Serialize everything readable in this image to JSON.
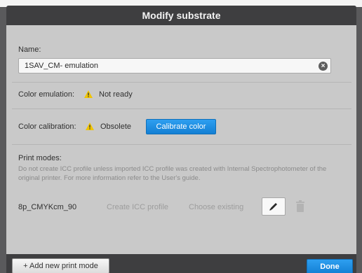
{
  "dialog": {
    "title": "Modify substrate"
  },
  "name": {
    "label": "Name:",
    "value": "1SAV_CM- emulation",
    "clear_icon": "clear-circle-x-icon"
  },
  "color_emulation": {
    "label": "Color emulation:",
    "status": "Not ready",
    "icon": "warning-icon"
  },
  "color_calibration": {
    "label": "Color calibration:",
    "status": "Obsolete",
    "icon": "warning-icon",
    "button_label": "Calibrate color"
  },
  "print_modes": {
    "label": "Print modes:",
    "description": "Do not create ICC profile unless imported ICC profile was created with Internal Spectrophotometer of the original printer. For more information refer to the User's guide.",
    "items": [
      {
        "name": "8p_CMYKcm_90",
        "create_icc_label": "Create ICC profile",
        "choose_existing_label": "Choose existing",
        "edit_icon": "pencil-icon",
        "delete_icon": "trash-icon"
      }
    ]
  },
  "footer": {
    "add_mode_label": "+ Add new print mode",
    "done_label": "Done"
  },
  "colors": {
    "accent_blue": "#1a8ae0",
    "warning_yellow": "#f0c400",
    "titlebar": "#3e3e40",
    "panel": "#c9c9c9"
  }
}
